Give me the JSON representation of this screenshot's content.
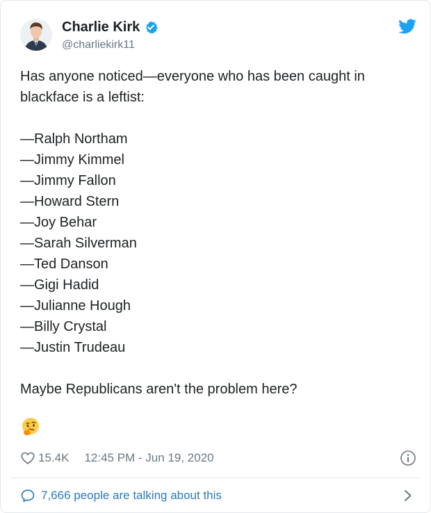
{
  "author": {
    "display_name": "Charlie Kirk",
    "handle": "@charliekirk11"
  },
  "icons": {
    "verified": "verified-badge-icon",
    "logo": "twitter-logo-icon",
    "emoji": "thinking-face-emoji",
    "heart": "heart-icon",
    "info": "info-icon",
    "reply_bubble": "speech-bubble-icon",
    "chevron": "chevron-right-icon"
  },
  "colors": {
    "accent": "#1da1f2",
    "link": "#2b7bb9",
    "muted": "#697882"
  },
  "tweet": {
    "intro": "Has anyone noticed—everyone who has been caught in blackface is a leftist:",
    "list": [
      "—Ralph Northam",
      "—Jimmy Kimmel",
      "—Jimmy Fallon",
      "—Howard Stern",
      "—Joy Behar",
      "—Sarah Silverman",
      "—Ted Danson",
      "—Gigi Hadid",
      "—Julianne Hough",
      "—Billy Crystal",
      "—Justin Trudeau"
    ],
    "closing": "Maybe Republicans aren't the problem here?",
    "emoji": "🤔"
  },
  "meta": {
    "likes": "15.4K",
    "timestamp": "12:45 PM - Jun 19, 2020"
  },
  "footer": {
    "talking": "7,666 people are talking about this"
  }
}
